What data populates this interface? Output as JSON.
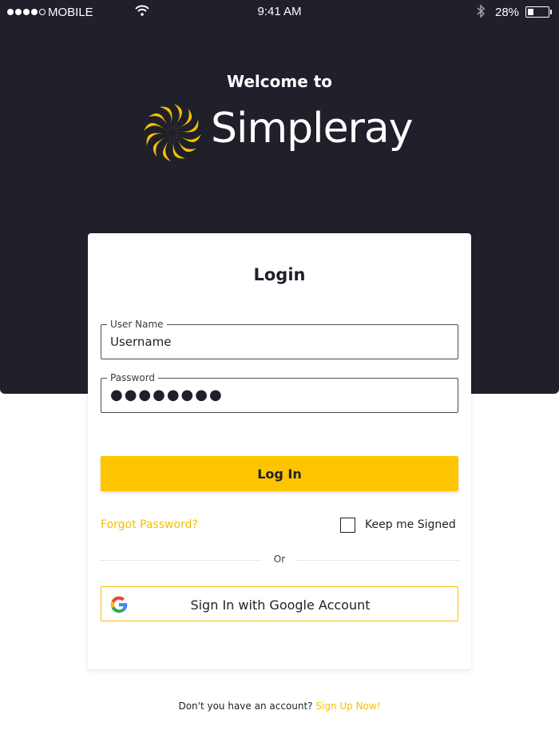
{
  "status_bar": {
    "carrier": "MOBILE",
    "time": "9:41 AM",
    "battery_percent": "28%",
    "battery_level": 0.28,
    "signal_strength": 4,
    "signal_max": 5
  },
  "header": {
    "welcome": "Welcome to",
    "brand": "Simpleray"
  },
  "login": {
    "title": "Login",
    "username_label": "User Name",
    "username_value": "Username",
    "password_label": "Password",
    "password_value": "●●●●●●●●",
    "login_button": "Log In",
    "forgot_password": "Forgot Password?",
    "keep_signed_label": "Keep me Signed",
    "keep_signed_checked": false,
    "or_text": "Or",
    "google_button": "Sign In with Google Account"
  },
  "footer": {
    "prompt": "Don't you have an account?",
    "signup_link": "Sign Up Now!"
  },
  "colors": {
    "hero_background": "#1f2029",
    "accent": "#fdc500",
    "text_dark": "#1f2029"
  },
  "icons": {
    "wifi": "wifi-icon",
    "bluetooth": "bluetooth-icon",
    "battery": "battery-icon",
    "brand": "sunburst-logo-icon",
    "google": "google-icon"
  }
}
